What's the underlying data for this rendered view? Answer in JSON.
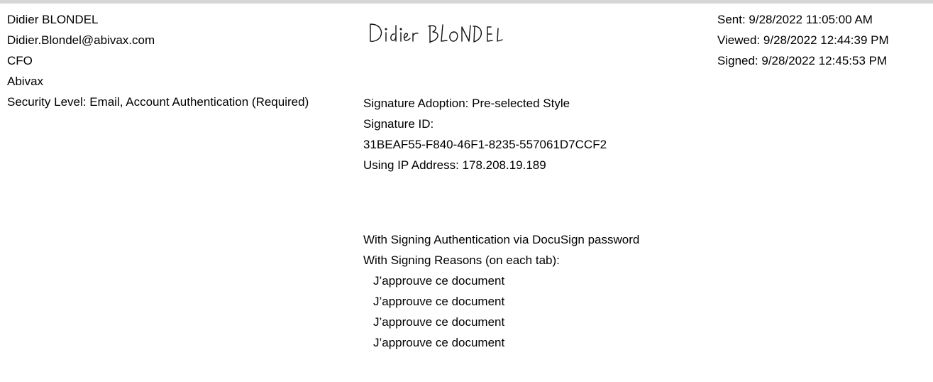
{
  "signer": {
    "name": "Didier BLONDEL",
    "email": "Didier.Blondel@abivax.com",
    "title": "CFO",
    "company": "Abivax",
    "security_level": "Security Level: Email, Account Authentication (Required)"
  },
  "signature": {
    "image_text": "Didier BLONDEL",
    "adoption": "Signature Adoption: Pre-selected Style",
    "id_label": "Signature ID:",
    "id_value": "31BEAF55-F840-46F1-8235-557061D7CCF2",
    "ip": "Using IP Address: 178.208.19.189",
    "auth": "With Signing Authentication via DocuSign password",
    "reasons_label": "With Signing Reasons (on each tab):",
    "reasons": [
      "J’approuve ce document",
      "J’approuve ce document",
      "J’approuve ce document",
      "J’approuve ce document"
    ]
  },
  "events": {
    "sent": "Sent: 9/28/2022 11:05:00 AM",
    "viewed": "Viewed: 9/28/2022 12:44:39 PM",
    "signed": "Signed: 9/28/2022 12:45:53 PM"
  }
}
